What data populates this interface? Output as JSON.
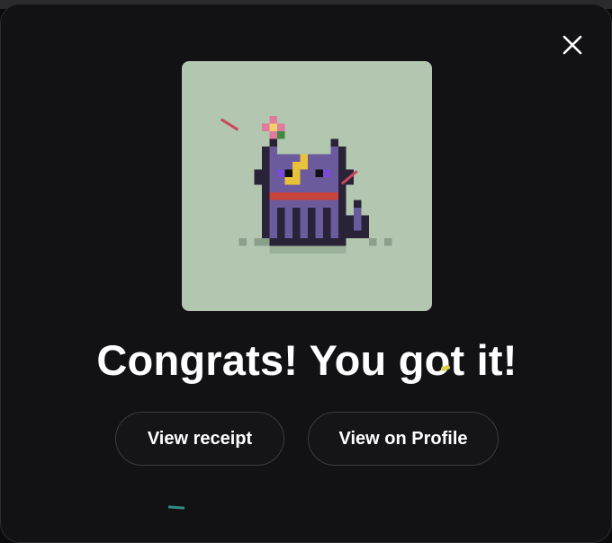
{
  "modal": {
    "title": "Congrats! You got it!",
    "close_icon": "close-icon",
    "buttons": {
      "view_receipt": "View receipt",
      "view_on_profile": "View on Profile"
    },
    "nft_image": "pixel-cat-nft"
  },
  "colors": {
    "modal_bg": "#121214",
    "art_bg": "#b2c6b0",
    "cat_body": "#6b5a9c",
    "cat_outline": "#2a2338",
    "collar": "#c8443c",
    "bolt": "#e8c23a",
    "text": "#ffffff"
  }
}
